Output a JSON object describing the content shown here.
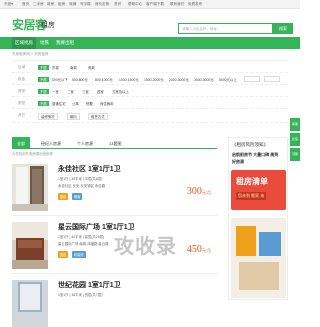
{
  "topbar": {
    "city": "东莞▾",
    "links": [
      "首页",
      "二手房",
      "新房",
      "租房",
      "商铺",
      "写字楼",
      "房价走势",
      "资讯",
      "帮助中心",
      "客户端下载",
      "联系我们",
      "免费发布"
    ]
  },
  "header": {
    "logo": "安居客",
    "city_label": "租房",
    "search_placeholder": "请输入小区名称、地址",
    "search_button": "搜索"
  },
  "nav": {
    "items": [
      "区域找房",
      "地铁",
      "我要出租"
    ]
  },
  "breadcrumb": "东莞租房网 > 东莞租房",
  "filters": [
    {
      "label": "区域",
      "options": [
        "不限",
        "东城",
        "南城",
        "莞城",
        "万江",
        "寮步",
        "松山湖",
        "虎门",
        "长安"
      ]
    },
    {
      "label": "租金",
      "options": [
        "不限",
        "500元以下",
        "500-800元",
        "800-1000元",
        "1000-1500元",
        "1500-2000元",
        "2000-3000元",
        "3000-5000元",
        "5000元以上"
      ]
    },
    {
      "label": "房型",
      "options": [
        "不限",
        "一室",
        "二室",
        "三室",
        "四室",
        "五室及以上"
      ]
    },
    {
      "label": "类型",
      "options": [
        "不限",
        "普通住宅",
        "公寓",
        "别墅",
        "商住两用"
      ]
    },
    {
      "label": "其它",
      "options": [
        "装修情况",
        "朝向",
        "租赁方式"
      ]
    }
  ],
  "tabs": [
    "全部",
    "经纪人房源",
    "个人房源",
    "13套图"
  ],
  "result_note": "为您找到东莞房源出租房源",
  "listings": [
    {
      "title": "永佳社区 1室1厅1卫",
      "meta1": "1室1厅 | 35平米 | 中层(共6层)",
      "meta2": "永佳社区  长安-长安镇区  永佳路",
      "tag1": "整租",
      "tag2": "朝南",
      "price": "300",
      "unit": "元/月"
    },
    {
      "title": "星云国际广场 1室1厅1卫",
      "meta1": "1室1厅 | 40平米 | 高层(共28层)",
      "meta2": "星云国际广场  南城-鸿福路  星云路",
      "tag1": "整租",
      "tag2": "精装修",
      "price": "450",
      "unit": "元/月"
    },
    {
      "title": "世纪花园 1室1厅1卫",
      "meta1": "1室1厅 | 38平米 | 低层(共7层)",
      "meta2": "世纪花园  东城-东城中心",
      "tag1": "整租",
      "tag2": "近地铁",
      "price": "",
      "unit": ""
    }
  ],
  "sidebar": {
    "heading": "《租房风险须知》",
    "text1": "启航前房节 大量口碑 周到",
    "text2": "好房源",
    "ad1": "租房清单",
    "ad2": "您未到 搬家 来"
  },
  "float": [
    "客服",
    "反馈",
    "顶部"
  ],
  "watermark": "攻收录",
  "colors": {
    "accent": "#35b558",
    "price": "#e5551d",
    "tag_orange": "#f0a11b",
    "tag_blue": "#5a9bd4"
  }
}
